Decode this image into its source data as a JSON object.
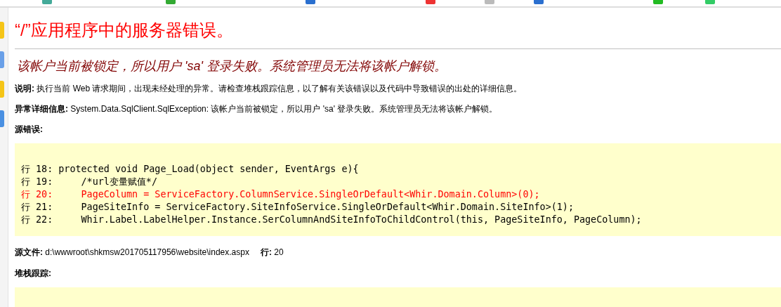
{
  "title": "“/”应用程序中的服务器错误。",
  "message": "该帐户当前被锁定，所以用户 'sa' 登录失败。系统管理员无法将该帐户解锁。",
  "description": "**说明:** 执行当前 Web 请求期间，出现未经处理的异常。请检查堆栈跟踪信息，以了解有关该错误以及代码中导致错误的出处的详细信息。",
  "exception_details": "**异常详细信息:** System.Data.SqlClient.SqlException: 该帐户当前被锁定，所以用户 'sa' 登录失败。系统管理员无法将该帐户解锁。",
  "source_error": {
    "label": "源错误:",
    "lines": [
      {
        "text": "行 18: protected void Page_Load(object sender, EventArgs e){",
        "highlighted": false
      },
      {
        "text": "行 19:     /*url变量赋值*/",
        "highlighted": false
      },
      {
        "text": "行 20:     PageColumn = ServiceFactory.ColumnService.SingleOrDefault<Whir.Domain.Column>(0);",
        "highlighted": true
      },
      {
        "text": "行 21:     PageSiteInfo = ServiceFactory.SiteInfoService.SingleOrDefault<Whir.Domain.SiteInfo>(1);",
        "highlighted": false
      },
      {
        "text": "行 22:     Whir.Label.LabelHelper.Instance.SerColumnAndSiteInfoToChildControl(this, PageSiteInfo, PageColumn);",
        "highlighted": false
      }
    ]
  },
  "source_file": {
    "label": "源文件:",
    "path": "d:\\wwwroot\\shkmsw201705117956\\website\\index.aspx",
    "line_label": "行:",
    "line": "20"
  },
  "stack_trace": {
    "label": "堆栈跟踪:"
  }
}
